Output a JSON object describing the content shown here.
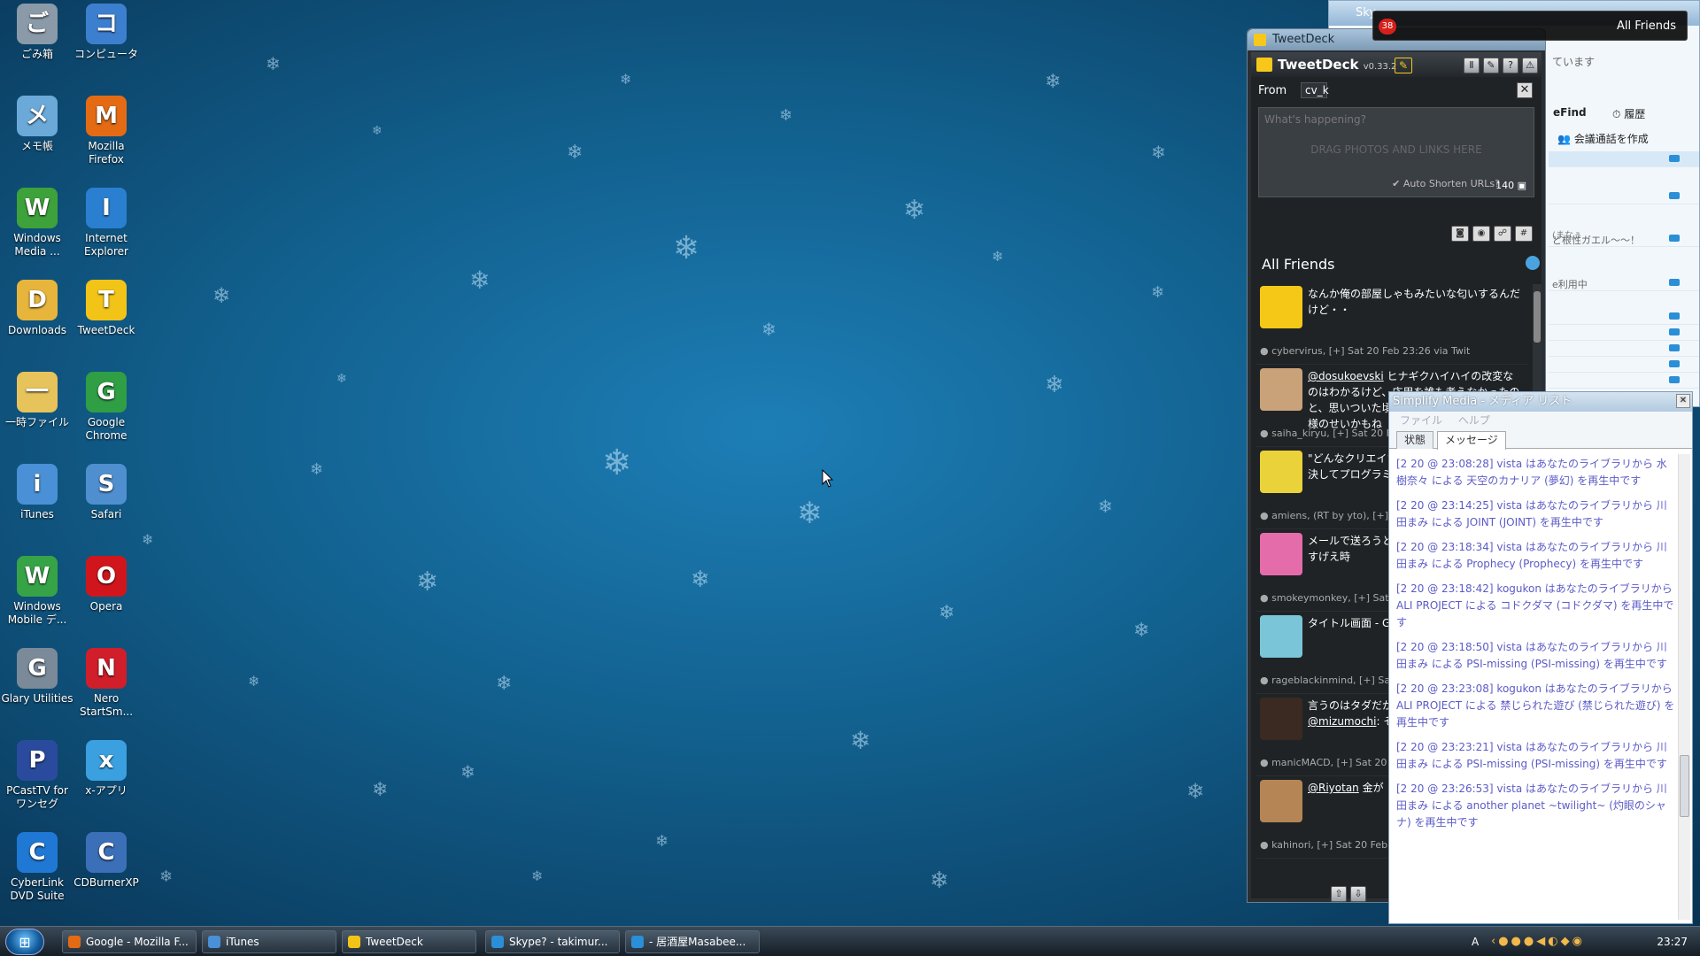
{
  "desktop_icons": [
    {
      "label": "ごみ箱",
      "icon": "recycle-bin-icon",
      "color": "#8a9aa8"
    },
    {
      "label": "コンピュータ",
      "icon": "computer-icon",
      "color": "#3d7fcf"
    },
    {
      "label": "メモ帳",
      "icon": "notepad-icon",
      "color": "#6aa9d8"
    },
    {
      "label": "Mozilla Firefox",
      "icon": "firefox-icon",
      "color": "#e46b14"
    },
    {
      "label": "Windows Media ...",
      "icon": "windows-media-icon",
      "color": "#3ea23a"
    },
    {
      "label": "Internet Explorer",
      "icon": "internet-explorer-icon",
      "color": "#2a7fd1"
    },
    {
      "label": "Downloads",
      "icon": "folder-icon",
      "color": "#e7b53b"
    },
    {
      "label": "TweetDeck",
      "icon": "tweetdeck-icon",
      "color": "#f2c417"
    },
    {
      "label": "一時ファイル",
      "icon": "folder-icon",
      "color": "#e7c35b"
    },
    {
      "label": "Google Chrome",
      "icon": "chrome-icon",
      "color": "#2f9e44"
    },
    {
      "label": "iTunes",
      "icon": "itunes-icon",
      "color": "#4a90d6"
    },
    {
      "label": "Safari",
      "icon": "safari-icon",
      "color": "#4f8fd0"
    },
    {
      "label": "Windows Mobile デ...",
      "icon": "windows-mobile-icon",
      "color": "#37a347"
    },
    {
      "label": "Opera",
      "icon": "opera-icon",
      "color": "#d0161c"
    },
    {
      "label": "Glary Utilities",
      "icon": "glary-icon",
      "color": "#7a8a98"
    },
    {
      "label": "Nero StartSm...",
      "icon": "nero-icon",
      "color": "#d01e2a"
    },
    {
      "label": "PCastTV for ワンセグ",
      "icon": "pcasttv-icon",
      "color": "#2a4b9d"
    },
    {
      "label": "x-アプリ",
      "icon": "x-app-icon",
      "color": "#3aa0e0"
    },
    {
      "label": "CyberLink DVD Suite",
      "icon": "cyberlink-icon",
      "color": "#1f78d4"
    },
    {
      "label": "CDBurnerXP",
      "icon": "cdburner-icon",
      "color": "#3b6fb8"
    }
  ],
  "taskbar": {
    "items": [
      "Google - Mozilla F...",
      "iTunes",
      "TweetDeck",
      "Skype? - takimur...",
      "- 居酒屋Masabee..."
    ],
    "clock": "23:27",
    "tray_label": "A"
  },
  "skype": {
    "title": "Sky",
    "status": "ています",
    "find": "eFind",
    "history": "履歴",
    "conference": "会議通話を作成",
    "row_texts": [
      "",
      "",
      "ど根性ガエル〜〜！",
      "e利用中",
      "",
      "",
      "",
      "",
      ""
    ],
    "row_extra": "(まなぅ"
  },
  "notification": {
    "count": "38",
    "label": "All Friends"
  },
  "tweetdeck": {
    "window_title": "TweetDeck",
    "app_name": "TweetDeck",
    "version": "v0.33.2",
    "from_label": "From",
    "from_account": "cv_k",
    "placeholder": "What's happening?",
    "drag_hint": "DRAG PHOTOS AND LINKS HERE",
    "auto_shorten": "Auto Shorten URLs?",
    "char_count": "140",
    "column_title": "All Friends",
    "tweets": [
      {
        "text": "なんか俺の部屋しゃもみたいな匂いするんだけど・・",
        "meta": "cybervirus, [+] Sat 20 Feb 23:26 via Twit",
        "avatar_color": "#f5c818"
      },
      {
        "mention": "@dosukoevski",
        "text": " ヒナギクハイハイの改変なのはわかるけど、応用を誰も考えなかったのと、思いついた頃にはEDが変わるという仕様のせいかもね",
        "meta": "saiha_kiryu, [+] Sat 20 Feb 2",
        "avatar_color": "#caa27a"
      },
      {
        "text": "\"どんなクリエイたいな作業だ。\"ン学校では決してプログラミングの€",
        "meta": "amiens, (RT by yto), [+] Sat 2",
        "avatar_color": "#e9d23a"
      },
      {
        "text": "メールで送ろうとちゃったので急遽てるけどすげえ時",
        "meta": "smokeymonkey, [+] Sat 20 Fe",
        "avatar_color": "#e46cab"
      },
      {
        "text": "タイトル画面 - GU 25/43) [Tag=am",
        "meta": "rageblackinmind, [+] Sat 20",
        "avatar_color": "#7bc5d8"
      },
      {
        "text": "言うのはタダだかランカーいいよね",
        "mention2": "@mizumochi",
        "text2": ": そ F-15Jイーグル:",
        "meta": "manicMACD, [+] Sat 20 Feb",
        "avatar_color": "#3a2a22"
      },
      {
        "mention": "@Riyotan",
        "text": " 金が",
        "meta": "kahinori, [+] Sat 20 Feb 23:2",
        "avatar_color": "#b58556"
      }
    ]
  },
  "simplify": {
    "title": "Simplify Media - メディア リスト",
    "menu": [
      "ファイル",
      "ヘルプ"
    ],
    "tabs": [
      "状態",
      "メッセージ"
    ],
    "messages": [
      "[2 20 @ 23:08:28] vista はあなたのライブラリから 水樹奈々 による 天空のカナリア (夢幻) を再生中です",
      "[2 20 @ 23:14:25] vista はあなたのライブラリから 川田まみ による JOINT (JOINT) を再生中です",
      "[2 20 @ 23:18:34] vista はあなたのライブラリから 川田まみ による Prophecy (Prophecy) を再生中です",
      "[2 20 @ 23:18:42] kogukon はあなたのライブラリから ALI PROJECT による コドクダマ (コドクダマ) を再生中です",
      "[2 20 @ 23:18:50] vista はあなたのライブラリから 川田まみ による PSI-missing (PSI-missing) を再生中です",
      "[2 20 @ 23:23:08] kogukon はあなたのライブラリから ALI PROJECT による 禁じられた遊び (禁じられた遊び) を再生中です",
      "[2 20 @ 23:23:21] vista はあなたのライブラリから 川田まみ による PSI-missing (PSI-missing) を再生中です",
      "[2 20 @ 23:26:53] vista はあなたのライブラリから 川田まみ による another planet ~twilight~ (灼眼のシャナ) を再生中です"
    ]
  }
}
